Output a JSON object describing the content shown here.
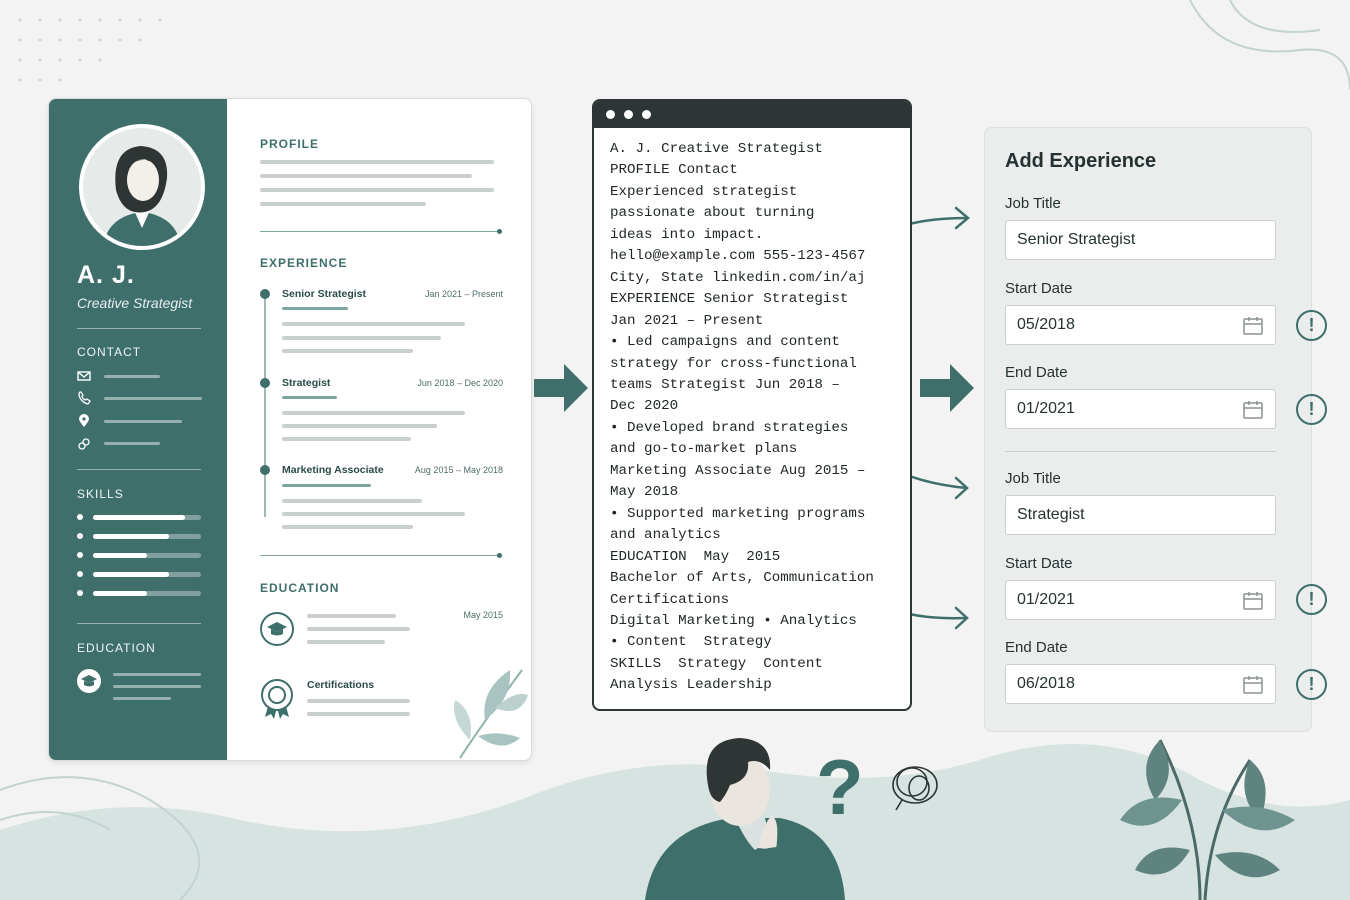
{
  "resume": {
    "name": "A. J.",
    "role": "Creative Strategist",
    "sidebar_headings": {
      "contact": "CONTACT",
      "skills": "SKILLS",
      "education": "EDUCATION"
    },
    "skill_levels": [
      0.85,
      0.7,
      0.5,
      0.7,
      0.5
    ],
    "contact_icons": [
      "envelope-icon",
      "phone-icon",
      "location-pin-icon",
      "link-icon"
    ],
    "sections": {
      "profile": "PROFILE",
      "experience": "EXPERIENCE",
      "education": "EDUCATION"
    },
    "jobs": [
      {
        "title": "Senior Strategist",
        "dates": "Jan 2021 – Present"
      },
      {
        "title": "Strategist",
        "dates": "Jun 2018 – Dec 2020"
      },
      {
        "title": "Marketing Associate",
        "dates": "Aug 2015 – May 2018"
      }
    ],
    "education_date": "May 2015",
    "certifications_label": "Certifications"
  },
  "extracted_text": [
    "A. J. Creative Strategist",
    "PROFILE Contact",
    "Experienced strategist",
    "passionate about turning",
    "ideas into impact.",
    "hello@example.com 555-123-4567",
    "City, State linkedin.com/in/aj",
    "EXPERIENCE Senior Strategist",
    "Jan 2021 – Present",
    "• Led campaigns and content",
    "strategy for cross-functional",
    "teams Strategist Jun 2018 –",
    "Dec 2020",
    "• Developed brand strategies",
    "and go-to-market plans",
    "Marketing Associate Aug 2015 –",
    "May 2018",
    "• Supported marketing programs",
    "and analytics",
    "EDUCATION  May  2015",
    "Bachelor of Arts, Communication",
    "Certifications",
    "Digital Marketing • Analytics",
    "• Content  Strategy",
    "SKILLS  Strategy  Content",
    "Analysis Leadership"
  ],
  "form": {
    "title": "Add Experience",
    "entries": [
      {
        "job_title_label": "Job Title",
        "job_title": "Senior Strategist",
        "start_label": "Start Date",
        "start": "05/2018",
        "end_label": "End Date",
        "end": "01/2021"
      },
      {
        "job_title_label": "Job Title",
        "job_title": "Strategist",
        "start_label": "Start Date",
        "start": "01/2021",
        "end_label": "End Date",
        "end": "06/2018"
      }
    ],
    "warning_symbol": "!"
  },
  "colors": {
    "accent": "#3f6f6b",
    "dark": "#2e3536",
    "background": "#f2f3f2"
  }
}
